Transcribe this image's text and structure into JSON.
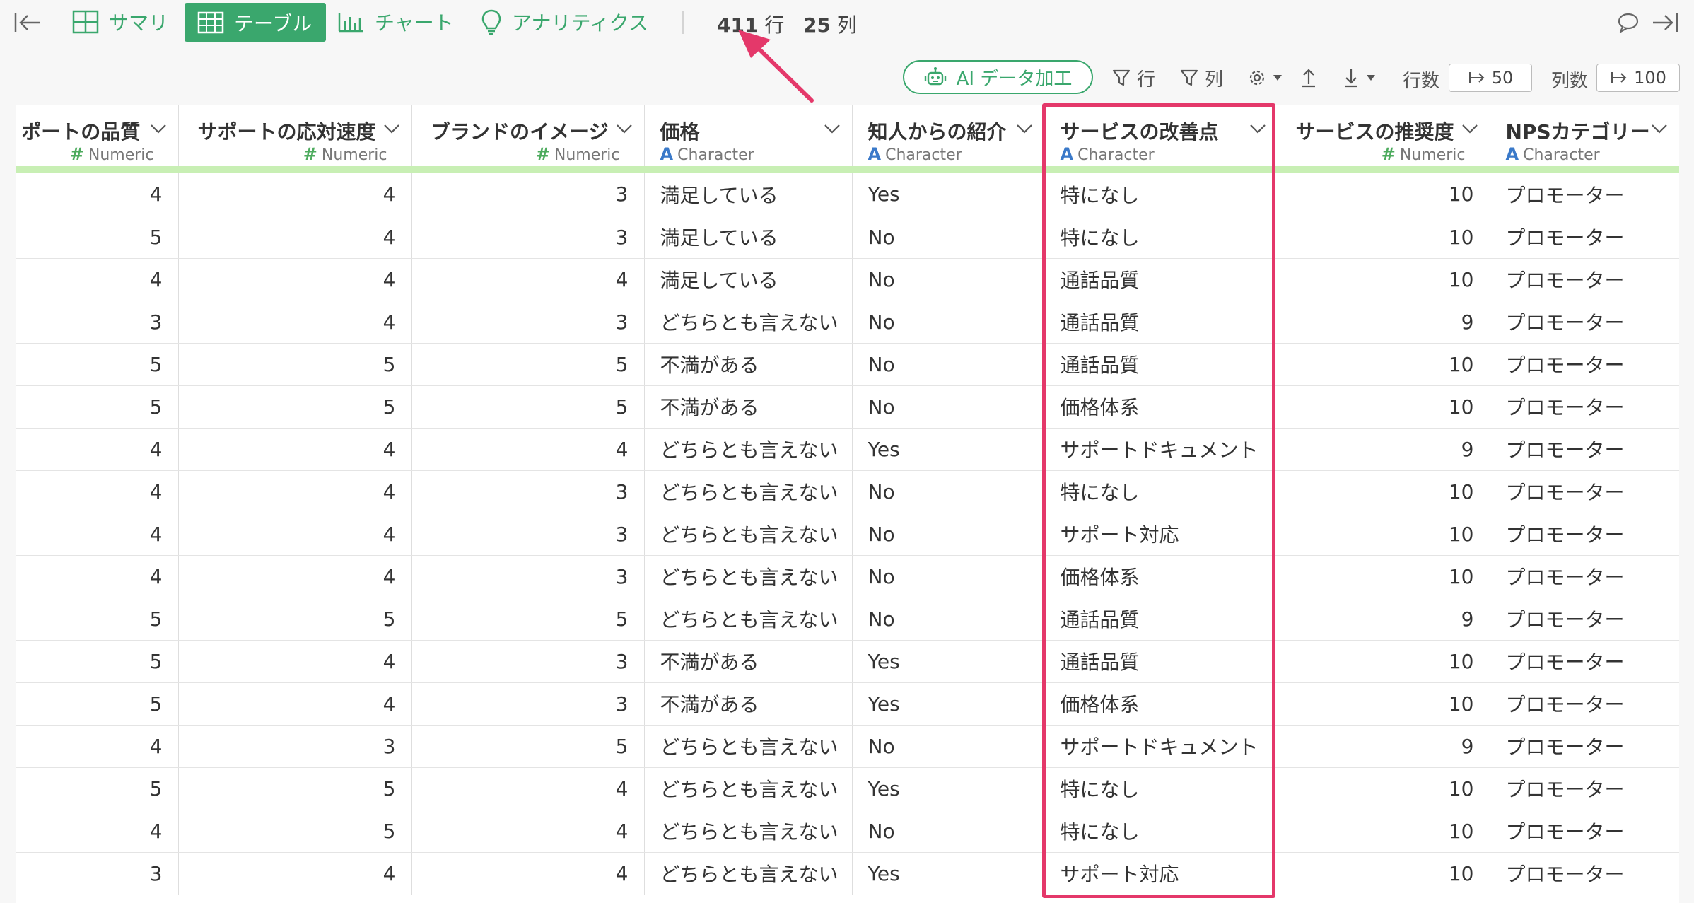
{
  "nav": {
    "summary_label": "サマリ",
    "table_label": "テーブル",
    "chart_label": "チャート",
    "analytics_label": "アナリティクス",
    "rows_count": "411",
    "rows_unit": "行",
    "cols_count": "25",
    "cols_unit": "列"
  },
  "toolbar": {
    "ai_label": "AI データ加工",
    "filter_rows_label": "行",
    "filter_cols_label": "列",
    "row_count_label": "行数",
    "row_count_value": "50",
    "col_count_label": "列数",
    "col_count_value": "100"
  },
  "table": {
    "columns": [
      {
        "name": "ポートの品質",
        "type": "Numeric",
        "kind": "num"
      },
      {
        "name": "サポートの応対速度",
        "type": "Numeric",
        "kind": "num"
      },
      {
        "name": "ブランドのイメージ",
        "type": "Numeric",
        "kind": "num"
      },
      {
        "name": "価格",
        "type": "Character",
        "kind": "chr"
      },
      {
        "name": "知人からの紹介",
        "type": "Character",
        "kind": "chr"
      },
      {
        "name": "サービスの改善点",
        "type": "Character",
        "kind": "chr"
      },
      {
        "name": "サービスの推奨度",
        "type": "Numeric",
        "kind": "num"
      },
      {
        "name": "NPSカテゴリー",
        "type": "Character",
        "kind": "chr"
      }
    ],
    "rows": [
      [
        "4",
        "4",
        "3",
        "満足している",
        "Yes",
        "特になし",
        "10",
        "プロモーター"
      ],
      [
        "5",
        "4",
        "3",
        "満足している",
        "No",
        "特になし",
        "10",
        "プロモーター"
      ],
      [
        "4",
        "4",
        "4",
        "満足している",
        "No",
        "通話品質",
        "10",
        "プロモーター"
      ],
      [
        "3",
        "4",
        "3",
        "どちらとも言えない",
        "No",
        "通話品質",
        "9",
        "プロモーター"
      ],
      [
        "5",
        "5",
        "5",
        "不満がある",
        "No",
        "通話品質",
        "10",
        "プロモーター"
      ],
      [
        "5",
        "5",
        "5",
        "不満がある",
        "No",
        "価格体系",
        "10",
        "プロモーター"
      ],
      [
        "4",
        "4",
        "4",
        "どちらとも言えない",
        "Yes",
        "サポートドキュメント",
        "9",
        "プロモーター"
      ],
      [
        "4",
        "4",
        "3",
        "どちらとも言えない",
        "No",
        "特になし",
        "10",
        "プロモーター"
      ],
      [
        "4",
        "4",
        "3",
        "どちらとも言えない",
        "No",
        "サポート対応",
        "10",
        "プロモーター"
      ],
      [
        "4",
        "4",
        "3",
        "どちらとも言えない",
        "No",
        "価格体系",
        "10",
        "プロモーター"
      ],
      [
        "5",
        "5",
        "5",
        "どちらとも言えない",
        "No",
        "通話品質",
        "9",
        "プロモーター"
      ],
      [
        "5",
        "4",
        "3",
        "不満がある",
        "Yes",
        "通話品質",
        "10",
        "プロモーター"
      ],
      [
        "5",
        "4",
        "3",
        "不満がある",
        "Yes",
        "価格体系",
        "10",
        "プロモーター"
      ],
      [
        "4",
        "3",
        "5",
        "どちらとも言えない",
        "No",
        "サポートドキュメント",
        "9",
        "プロモーター"
      ],
      [
        "5",
        "5",
        "4",
        "どちらとも言えない",
        "Yes",
        "特になし",
        "10",
        "プロモーター"
      ],
      [
        "4",
        "5",
        "4",
        "どちらとも言えない",
        "No",
        "特になし",
        "10",
        "プロモーター"
      ],
      [
        "3",
        "4",
        "4",
        "どちらとも言えない",
        "Yes",
        "サポート対応",
        "10",
        "プロモーター"
      ]
    ]
  },
  "colors": {
    "accent": "#3aa76d",
    "highlight": "#e4386a",
    "numeric_type": "#4dab5e",
    "character_type": "#3a79c9",
    "type_bar": "#c8efb4"
  }
}
